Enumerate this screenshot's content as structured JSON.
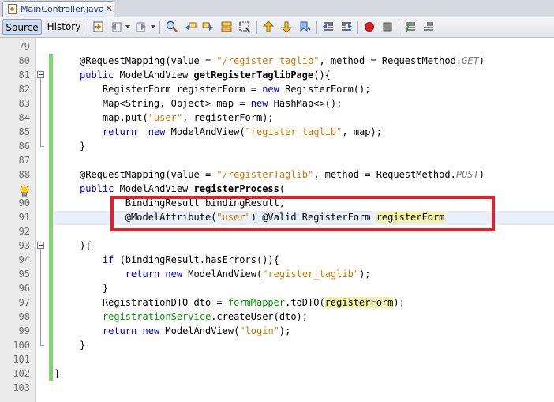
{
  "tab": {
    "filename": "MainController.java",
    "close": "✕"
  },
  "toolbar": {
    "source_label": "Source",
    "history_label": "History"
  },
  "editor": {
    "line_numbers": [
      "79",
      "80",
      "81",
      "82",
      "83",
      "84",
      "85",
      "86",
      "87",
      "88",
      "89",
      "90",
      "91",
      "92",
      "93",
      "94",
      "95",
      "96",
      "97",
      "98",
      "99",
      "100",
      "101",
      "102",
      "103"
    ],
    "code": {
      "l80": {
        "a": "@RequestMapping(value = ",
        "b": "\"/register_taglib\"",
        "c": ", method = RequestMethod.",
        "d": "GET",
        "e": ")"
      },
      "l81": {
        "a": "public",
        "b": " ModelAndView ",
        "c": "getRegisterTaglibPage",
        "d": "(){"
      },
      "l82": {
        "a": "    RegisterForm registerForm = ",
        "b": "new",
        "c": " RegisterForm();"
      },
      "l83": {
        "a": "    Map<String, Object> map = ",
        "b": "new",
        "c": " HashMap<>();"
      },
      "l84": {
        "a": "    map.put(",
        "b": "\"user\"",
        "c": ", registerForm);"
      },
      "l85": {
        "a": "    ",
        "b": "return",
        "c": "  ",
        "d": "new",
        "e": " ModelAndView(",
        "f": "\"register_taglib\"",
        "g": ", map);"
      },
      "l86": {
        "a": "}"
      },
      "l88": {
        "a": "@RequestMapping(value = ",
        "b": "\"/registerTaglib\"",
        "c": ", method = RequestMethod.",
        "d": "POST",
        "e": ")"
      },
      "l89": {
        "a": "public",
        "b": " ModelAndView ",
        "c": "registerProcess",
        "d": "("
      },
      "l90": {
        "a": "        BindingResult bindingResult,"
      },
      "l91": {
        "a": "        @ModelAttribute(",
        "b": "\"user\"",
        "c": ") @Valid RegisterForm ",
        "d": "registerForm"
      },
      "l93": {
        "a": "){"
      },
      "l94": {
        "a": "    ",
        "b": "if",
        "c": " (bindingResult.hasErrors()){"
      },
      "l95": {
        "a": "        ",
        "b": "return",
        "c": " ",
        "d": "new",
        "e": " ModelAndView(",
        "f": "\"register_taglib\"",
        "g": ");"
      },
      "l96": {
        "a": "    }"
      },
      "l97": {
        "a": "    RegistrationDTO dto = ",
        "b": "formMapper",
        "c": ".toDTO(",
        "d": "registerForm",
        "e": ");"
      },
      "l98": {
        "a": "    ",
        "b": "registrationService",
        "c": ".createUser(dto);"
      },
      "l99": {
        "a": "    ",
        "b": "return",
        "c": " ",
        "d": "new",
        "e": " ModelAndView(",
        "f": "\"login\"",
        "g": ");"
      },
      "l100": {
        "a": "}"
      },
      "l102": {
        "a": "}"
      }
    }
  }
}
